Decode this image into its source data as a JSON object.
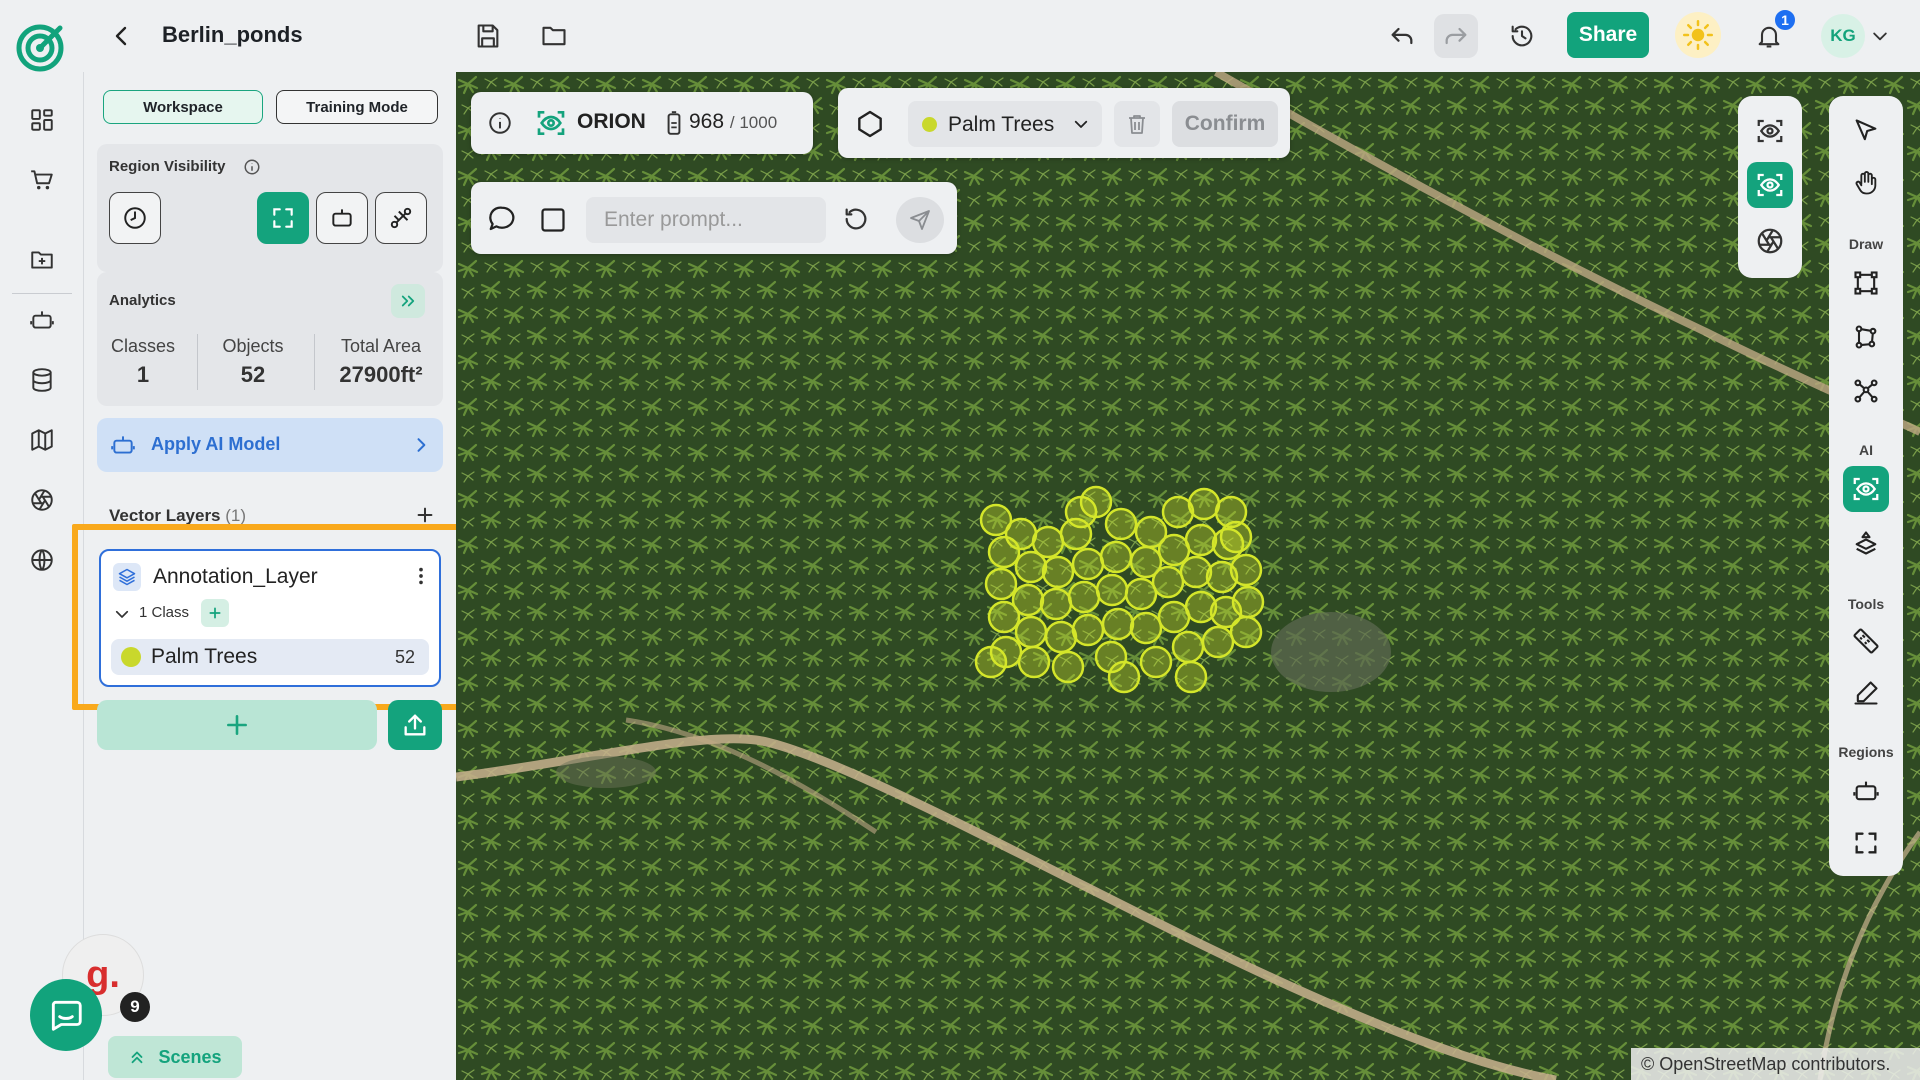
{
  "header": {
    "title": "Berlin_ponds",
    "share_label": "Share",
    "notification_count": "1",
    "user_initials": "KG"
  },
  "panel": {
    "modes": [
      "Workspace",
      "Training Mode"
    ],
    "region_visibility_label": "Region Visibility",
    "analytics": {
      "title": "Analytics",
      "classes_label": "Classes",
      "classes_value": "1",
      "objects_label": "Objects",
      "objects_value": "52",
      "area_label": "Total Area",
      "area_value": "27900ft²"
    },
    "apply_ai_label": "Apply AI Model",
    "vector_layers_label": "Vector Layers",
    "vector_layers_count": "(1)",
    "layer": {
      "name": "Annotation_Layer",
      "class_count_label": "1 Class",
      "class_name": "Palm Trees",
      "class_count": "52",
      "class_color": "#c9d82c"
    },
    "scenes_label": "Scenes",
    "widget_badge": "9",
    "widget_letter": "g."
  },
  "map": {
    "model_name": "ORION",
    "credits_used": "968",
    "credits_total": "/ 1000",
    "selected_class": "Palm Trees",
    "confirm_label": "Confirm",
    "prompt_placeholder": "Enter prompt...",
    "attribution": "© OpenStreetMap contributors."
  },
  "tools": {
    "draw_label": "Draw",
    "ai_label": "AI",
    "tools_label": "Tools",
    "regions_label": "Regions"
  },
  "colors": {
    "accent": "#14a37d",
    "annotation": "#d4e62a",
    "highlight": "#f9a91c"
  }
}
